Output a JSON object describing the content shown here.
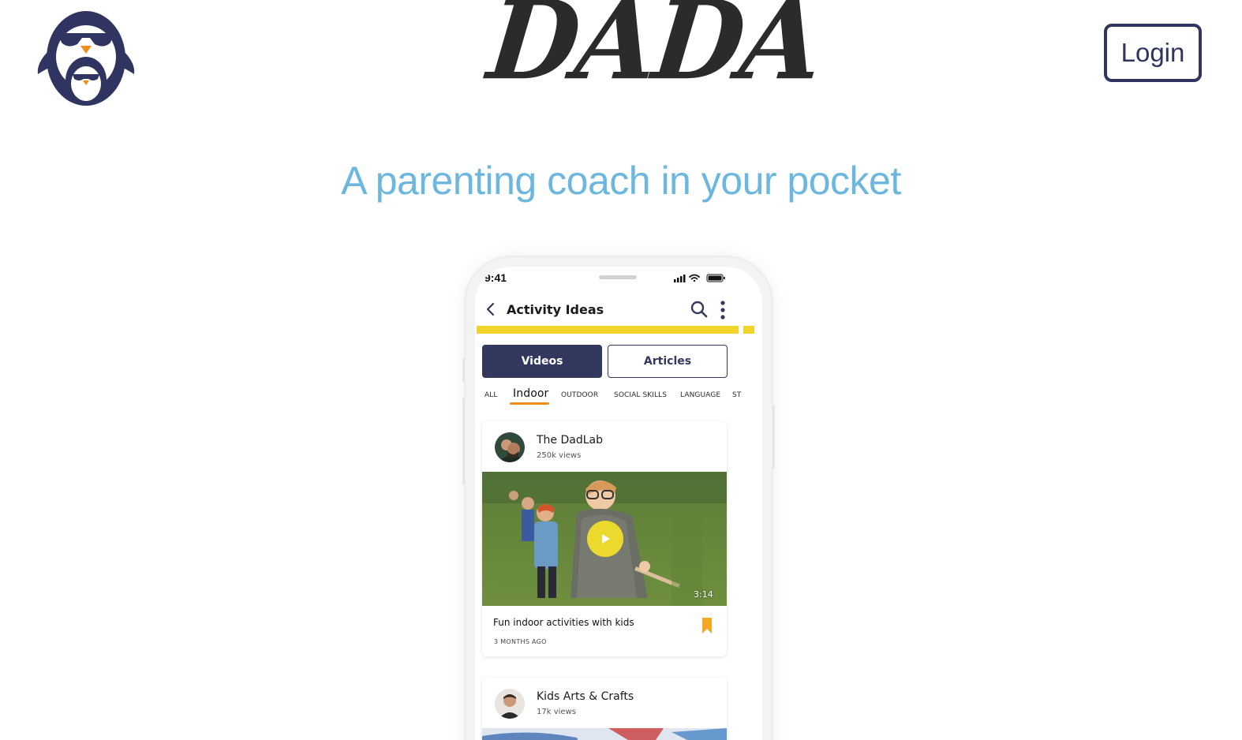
{
  "header": {
    "brand": "DADA",
    "login_label": "Login"
  },
  "hero": {
    "tagline": "A parenting coach in your pocket"
  },
  "phone": {
    "status_time": "9:41",
    "app_title": "Activity Ideas",
    "tabs": [
      {
        "label": "Videos",
        "selected": true
      },
      {
        "label": "Articles",
        "selected": false
      }
    ],
    "categories": [
      {
        "label": "ALL",
        "active": false
      },
      {
        "label": "Indoor",
        "active": true
      },
      {
        "label": "OUTDOOR",
        "active": false
      },
      {
        "label": "SOCIAL SKILLS",
        "active": false
      },
      {
        "label": "LANGUAGE",
        "active": false
      },
      {
        "label": "ST",
        "active": false
      }
    ],
    "cards": [
      {
        "channel": "The DadLab",
        "views": "250k views",
        "duration": "3:14",
        "title": "Fun indoor activities with kids",
        "age": "3 MONTHS AGO",
        "bookmarked": true
      },
      {
        "channel": "Kids Arts & Crafts",
        "views": "17k views"
      }
    ]
  },
  "colors": {
    "brand_navy": "#2f3560",
    "tagline_blue": "#6bb7df",
    "accent_yellow": "#f2d32a",
    "tab_active": "#33385f",
    "category_underline": "#f08c1a",
    "bookmark_orange": "#f5a623"
  },
  "icons": [
    "penguin-logo",
    "signal-icon",
    "wifi-icon",
    "battery-icon",
    "back-chevron-icon",
    "search-icon",
    "more-vertical-icon",
    "play-icon",
    "bookmark-icon"
  ]
}
